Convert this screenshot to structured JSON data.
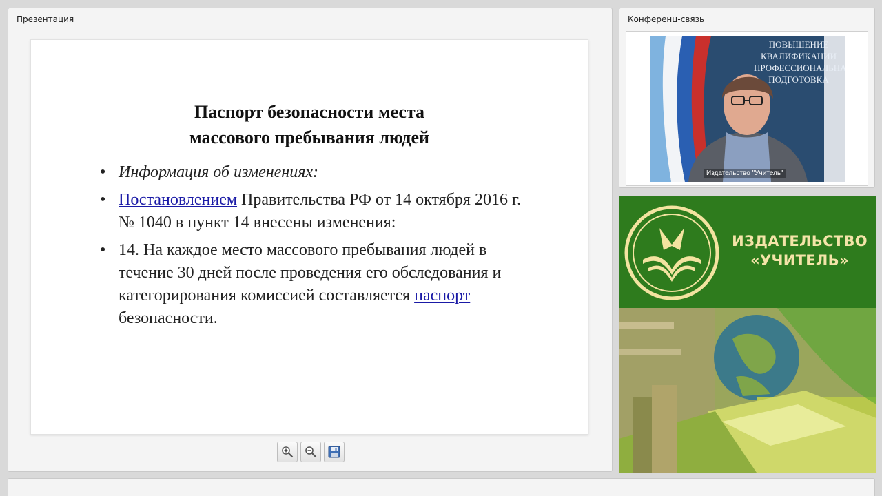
{
  "presentation": {
    "panel_title": "Презентация",
    "slide": {
      "title_line1": "Паспорт безопасности места",
      "title_line2": "массового пребывания людей",
      "bullet1": "Информация об изменениях:",
      "bullet2": {
        "link": "Постановлением",
        "text": " Правительства РФ от 14 октября 2016 г. № 1040 в пункт 14 внесены изменения:"
      },
      "bullet3": {
        "text_before": "14. На каждое место массового пребывания людей в течение 30 дней после проведения его обследования и категорирования комиссией составляется ",
        "link": "паспорт",
        "text_after": " безопасности."
      }
    },
    "toolbar": {
      "zoom_in_icon": "zoom-in-icon",
      "zoom_out_icon": "zoom-out-icon",
      "save_icon": "floppy-disk-icon"
    }
  },
  "conference": {
    "panel_title": "Конференц-связь",
    "video_label": "Издательство \"Учитель\"",
    "poster_text": "ПОВЫШЕНИЕ КВАЛИФИКАЦИИ ПРОФЕССИОНАЛЬНАЯ ПОДГОТОВКА"
  },
  "brand": {
    "name_line1": "ИЗДАТЕЛЬСТВО",
    "name_line2": "«УЧИТЕЛЬ»"
  },
  "colors": {
    "brand_green": "#2e7b1d",
    "brand_text": "#f4e4a8",
    "link": "#1a1aa6"
  }
}
